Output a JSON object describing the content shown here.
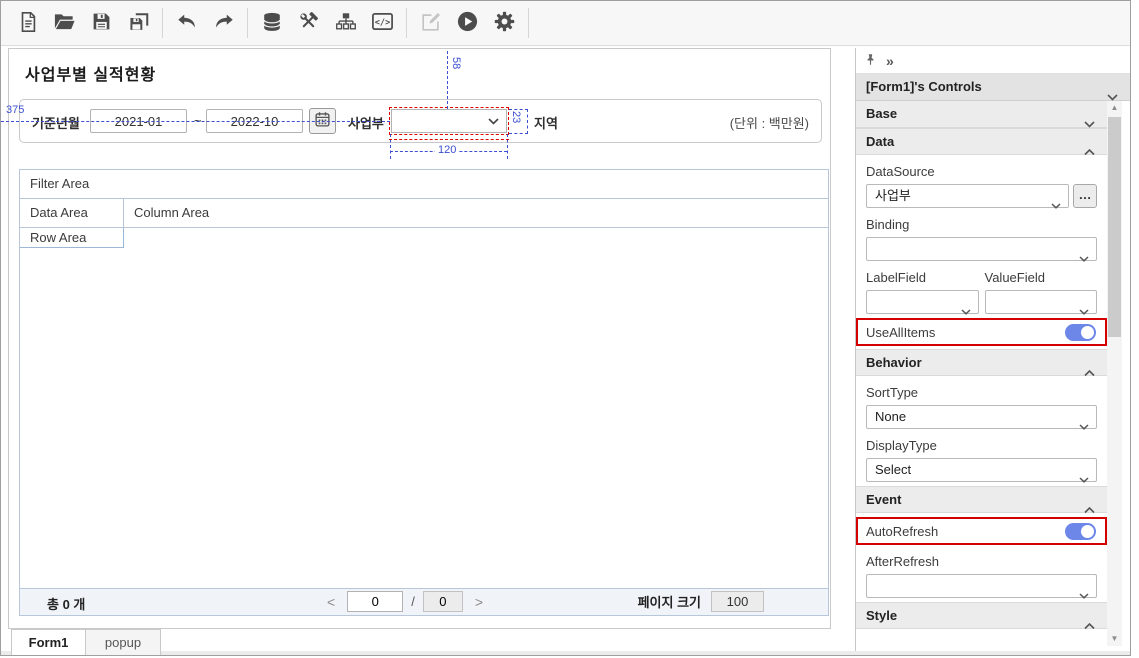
{
  "colors": {
    "toggle_accent": "#6c87e8",
    "highlight_red": "#d40000",
    "measure_blue": "#3b4fd0",
    "grid_border": "#b7c6d9"
  },
  "toolbar": {
    "icons": [
      "new-document",
      "open-folder",
      "save",
      "save-all",
      "undo",
      "redo",
      "database",
      "data-tools",
      "hierarchy",
      "code-view",
      "edit",
      "run",
      "settings"
    ]
  },
  "canvas": {
    "title": "사업부별 실적현황",
    "filter": {
      "period_label": "기준년월",
      "date_from": "2021-01",
      "range_separator": "~",
      "date_to": "2022-10",
      "division_label": "사업부",
      "region_label": "지역",
      "unit_note": "(단위 : 백만원)"
    },
    "measurements": {
      "top_offset": "58",
      "left_offset": "375",
      "control_width": "120",
      "control_height": "23"
    },
    "grid": {
      "filter_area": "Filter Area",
      "data_area": "Data Area",
      "column_area": "Column Area",
      "row_area": "Row Area"
    },
    "pagination": {
      "total_count": "총  0 개",
      "prev": "<",
      "current_page": "0",
      "separator": "/",
      "total_pages": "0",
      "next": ">",
      "page_size_label": "페이지 크기",
      "page_size": "100"
    }
  },
  "tabs": [
    {
      "label": "Form1"
    },
    {
      "label": "popup"
    }
  ],
  "panel": {
    "collapse_icon": "»",
    "controls_header": "[Form1]'s Controls",
    "base_section": "Base",
    "data_section": "Data",
    "behavior_section": "Behavior",
    "event_section": "Event",
    "style_section": "Style",
    "datasource_label": "DataSource",
    "datasource_value": "사업부",
    "more_button": "…",
    "binding_label": "Binding",
    "labelfield_label": "LabelField",
    "valuefield_label": "ValueField",
    "useallitems_label": "UseAllItems",
    "sorttype_label": "SortType",
    "sorttype_value": "None",
    "displaytype_label": "DisplayType",
    "displaytype_value": "Select",
    "autorefresh_label": "AutoRefresh",
    "afterrefresh_label": "AfterRefresh"
  }
}
